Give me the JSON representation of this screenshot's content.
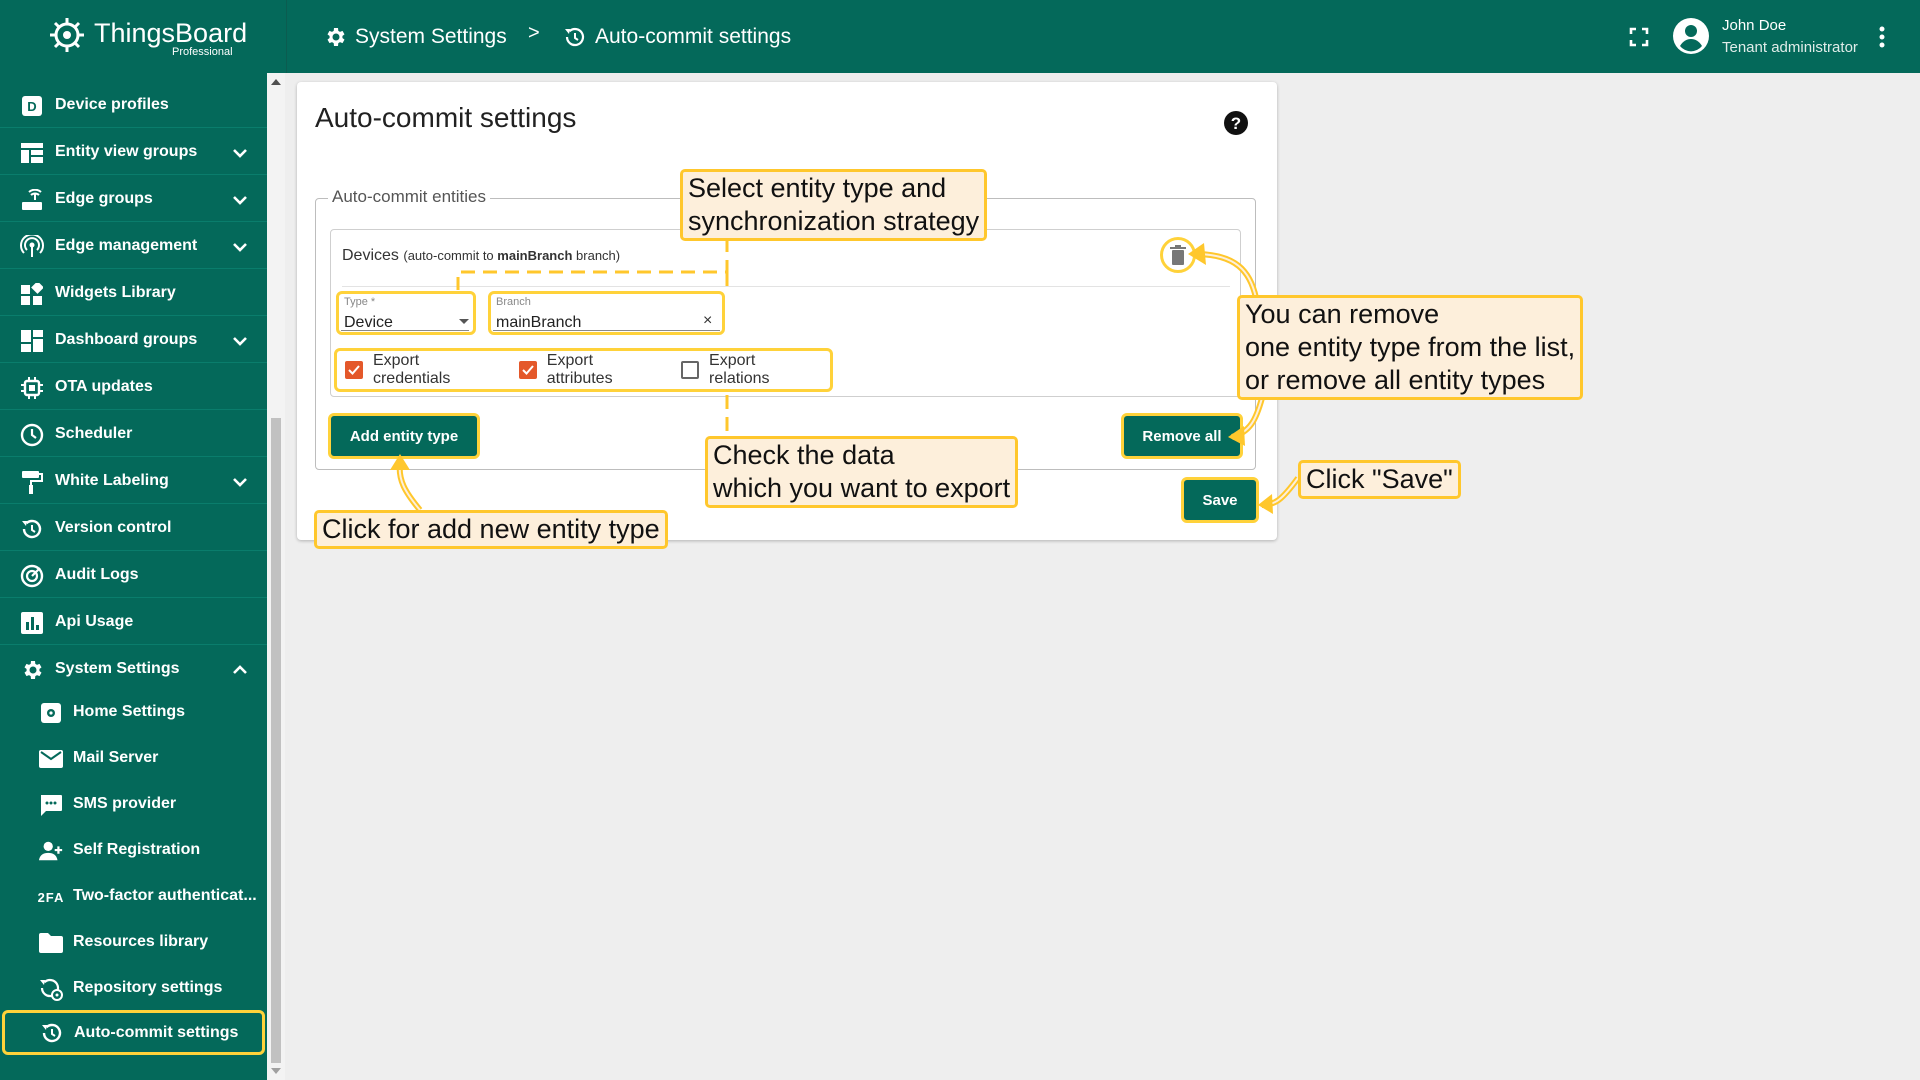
{
  "header": {
    "brand_name": "ThingsBoard",
    "brand_sub": "Professional",
    "breadcrumb": [
      {
        "label": "System Settings",
        "icon": "gear-icon"
      },
      {
        "label": "Auto-commit settings",
        "icon": "history-icon"
      }
    ],
    "separator": ">",
    "user": {
      "name": "John Doe",
      "role": "Tenant administrator"
    }
  },
  "sidebar": {
    "items": [
      {
        "label": "Device profiles",
        "icon": "device-profile-icon",
        "expandable": false
      },
      {
        "label": "Entity view groups",
        "icon": "view-grid-icon",
        "expandable": true
      },
      {
        "label": "Edge groups",
        "icon": "router-icon",
        "expandable": true
      },
      {
        "label": "Edge management",
        "icon": "antenna-icon",
        "expandable": true
      },
      {
        "label": "Widgets Library",
        "icon": "widgets-icon",
        "expandable": false
      },
      {
        "label": "Dashboard groups",
        "icon": "dashboard-icon",
        "expandable": true
      },
      {
        "label": "OTA updates",
        "icon": "memory-chip-icon",
        "expandable": false
      },
      {
        "label": "Scheduler",
        "icon": "clock-icon",
        "expandable": false
      },
      {
        "label": "White Labeling",
        "icon": "paint-roller-icon",
        "expandable": true
      },
      {
        "label": "Version control",
        "icon": "history-icon",
        "expandable": false
      },
      {
        "label": "Audit Logs",
        "icon": "track-changes-icon",
        "expandable": false
      },
      {
        "label": "Api Usage",
        "icon": "bar-chart-icon",
        "expandable": false
      },
      {
        "label": "System Settings",
        "icon": "gear-icon",
        "expandable": true
      }
    ],
    "sub_items": [
      {
        "label": "Home Settings",
        "icon": "home-settings-icon"
      },
      {
        "label": "Mail Server",
        "icon": "mail-icon"
      },
      {
        "label": "SMS provider",
        "icon": "sms-icon"
      },
      {
        "label": "Self Registration",
        "icon": "person-add-icon"
      },
      {
        "label": "Two-factor authenticat...",
        "icon": "two-factor-icon",
        "icon_text": "2FA"
      },
      {
        "label": "Resources library",
        "icon": "folder-icon"
      },
      {
        "label": "Repository settings",
        "icon": "repository-settings-icon"
      },
      {
        "label": "Auto-commit settings",
        "icon": "history-icon"
      }
    ]
  },
  "main": {
    "title": "Auto-commit settings",
    "fieldset_legend": "Auto-commit entities",
    "entity": {
      "name": "Devices",
      "caption_prefix": "(auto-commit to ",
      "branch_bold": "mainBranch",
      "caption_suffix": " branch)",
      "type_label": "Type *",
      "type_value": "Device",
      "branch_label": "Branch",
      "branch_value": "mainBranch",
      "clear_symbol": "×",
      "checkboxes": [
        {
          "label": "Export credentials",
          "checked": true
        },
        {
          "label": "Export attributes",
          "checked": true
        },
        {
          "label": "Export relations",
          "checked": false
        }
      ]
    },
    "add_button": "Add entity type",
    "remove_all_button": "Remove all",
    "save_button": "Save"
  },
  "annotations": {
    "select_type_line1": "Select entity type and",
    "select_type_line2": "synchronization strategy",
    "remove_line1": "You can remove",
    "remove_line2": "one entity type from the list,",
    "remove_line3": "or remove all entity types",
    "check_line1": "Check the data",
    "check_line2": "which you want to export",
    "click_save": "Click \"Save\"",
    "click_add": "Click for add new entity type"
  },
  "colors": {
    "primary": "#04695a",
    "highlight": "#ffd23a",
    "callout_fill": "#fdefdb",
    "checkbox_on": "#e4582a"
  }
}
